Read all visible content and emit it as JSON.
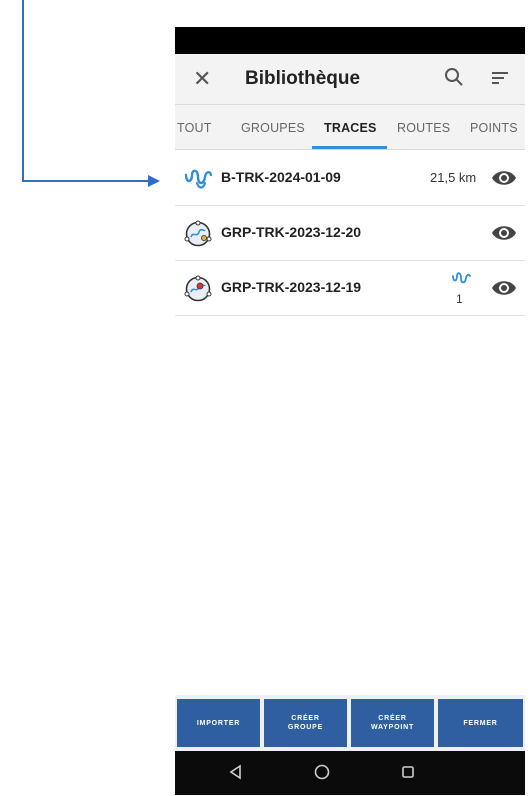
{
  "app": {
    "title": "Bibliothèque"
  },
  "tabs": [
    {
      "label": "TOUT"
    },
    {
      "label": "GROUPES"
    },
    {
      "label": "TRACES"
    },
    {
      "label": "ROUTES"
    },
    {
      "label": "POINTS"
    }
  ],
  "active_tab": "TRACES",
  "items": [
    {
      "name": "B-TRK-2024-01-09",
      "distance": "21,5 km",
      "icon": "track-icon"
    },
    {
      "name": "GRP-TRK-2023-12-20",
      "icon": "group-track-icon"
    },
    {
      "name": "GRP-TRK-2023-12-19",
      "icon": "group-track-icon",
      "track_count": "1"
    }
  ],
  "buttons": {
    "import": "IMPORTER",
    "create_group": "CRÉER\nGROUPE",
    "create_waypoint": "CRÉER\nWAYPOINT",
    "close": "FERMER"
  },
  "colors": {
    "accent": "#2f8fd8",
    "button": "#2f5fa0",
    "annotation_arrow": "#2f6fc8"
  }
}
